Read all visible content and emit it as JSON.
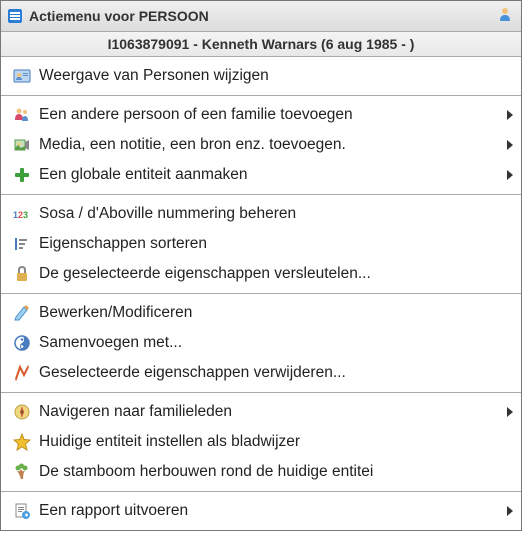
{
  "header": {
    "title": "Actiemenu voor PERSOON",
    "subtitle": "I1063879091 - Kenneth Warnars (6 aug 1985 - )"
  },
  "menu": [
    {
      "items": [
        {
          "icon": "person-card",
          "label": "Weergave van Personen wijzigen",
          "submenu": false
        }
      ]
    },
    {
      "items": [
        {
          "icon": "family",
          "label": "Een andere persoon of een familie toevoegen",
          "submenu": true
        },
        {
          "icon": "media",
          "label": "Media, een notitie, een bron enz. toevoegen.",
          "submenu": true
        },
        {
          "icon": "plus",
          "label": "Een globale entiteit aanmaken",
          "submenu": true
        }
      ]
    },
    {
      "items": [
        {
          "icon": "numbers",
          "label": "Sosa / d'Aboville nummering beheren",
          "submenu": false
        },
        {
          "icon": "sort",
          "label": "Eigenschappen sorteren",
          "submenu": false
        },
        {
          "icon": "lock",
          "label": "De geselecteerde eigenschappen versleutelen...",
          "submenu": false
        }
      ]
    },
    {
      "items": [
        {
          "icon": "edit",
          "label": "Bewerken/Modificeren",
          "submenu": false
        },
        {
          "icon": "merge",
          "label": "Samenvoegen met...",
          "submenu": false
        },
        {
          "icon": "delete",
          "label": "Geselecteerde eigenschappen verwijderen...",
          "submenu": false
        }
      ]
    },
    {
      "items": [
        {
          "icon": "compass",
          "label": "Navigeren naar familieleden",
          "submenu": true
        },
        {
          "icon": "star",
          "label": "Huidige entiteit instellen als bladwijzer",
          "submenu": false
        },
        {
          "icon": "tree",
          "label": "De stamboom herbouwen rond de huidige entitei",
          "submenu": false
        }
      ]
    },
    {
      "items": [
        {
          "icon": "report",
          "label": "Een rapport uitvoeren",
          "submenu": true
        }
      ]
    }
  ]
}
